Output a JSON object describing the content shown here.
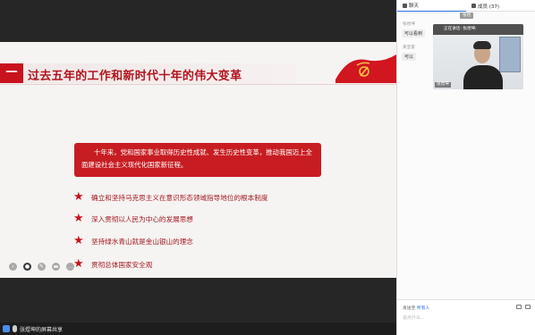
{
  "slide": {
    "title_num": "一",
    "title": "过去五年的工作和新时代十年的伟大变革",
    "callout": "十年来，党和国家事业取得历史性成就、发生历史性变革，推动我国迈上全面建设社会主义现代化国家新征程。",
    "points": [
      "确立和坚持马克思主义在意识形态领域指导地位的根本制度",
      "深入贯彻以人民为中心的发展思想",
      "坚持绿水青山就是金山银山的理念",
      "贯彻总体国家安全观"
    ],
    "accent_color": "#c8121e"
  },
  "bottom_bar": {
    "share_label": "张煜坤的屏幕共享"
  },
  "panel": {
    "tab_chat": "聊天",
    "tab_members": "成员 (37)",
    "badge": "张煜",
    "messages": [
      {
        "name": "张煜坤",
        "text": "可以看到"
      },
      {
        "name": "黄亚雷",
        "text": "可以"
      }
    ],
    "video": {
      "speaking": "正在讲话: 张煜坤;",
      "name": "张煜坤"
    },
    "send_to_label": "发送至",
    "send_to_target": "所有人",
    "input_placeholder": "说点什么..."
  }
}
